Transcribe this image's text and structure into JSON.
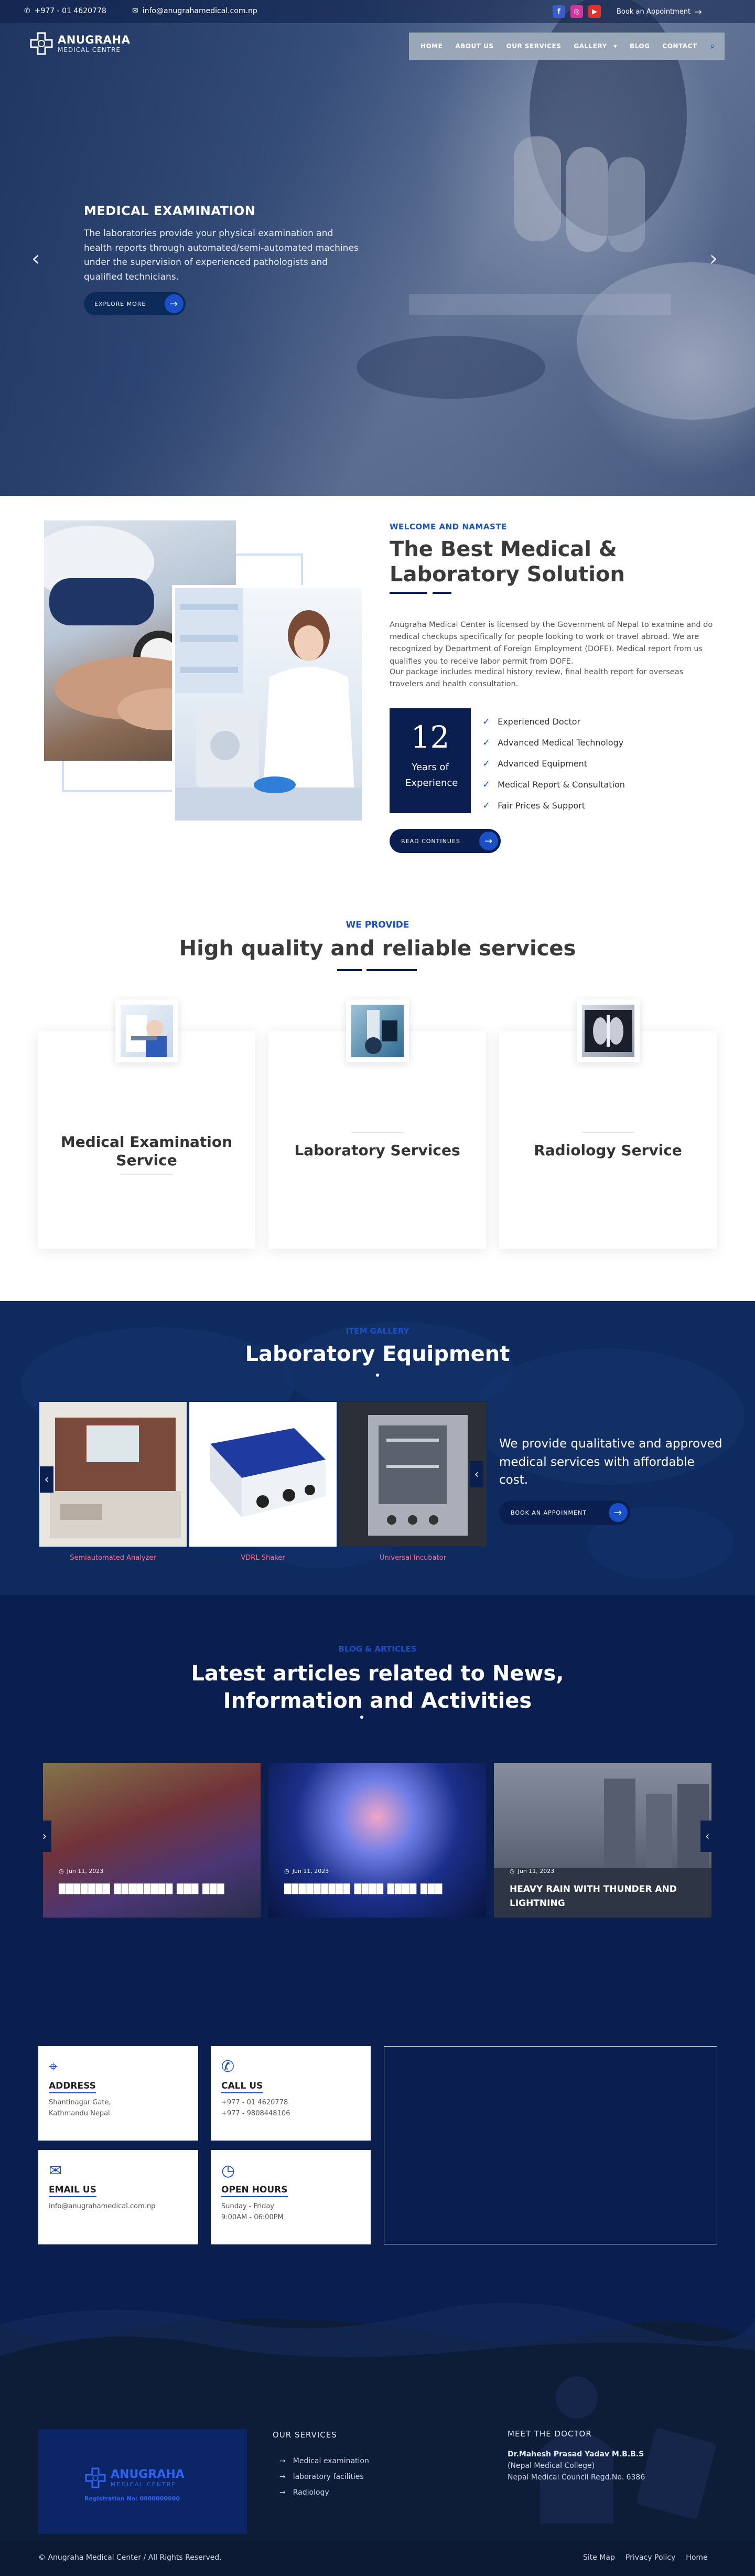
{
  "topbar": {
    "phone": "+977 - 01 4620778",
    "email": "info@anugrahamedical.com.np",
    "social": [
      "f",
      "◎",
      "▶"
    ],
    "appointment": "Book an Appointment"
  },
  "brand": {
    "name": "ANUGRAHA",
    "sub": "MEDICAL CENTRE"
  },
  "nav": {
    "items": [
      "HOME",
      "ABOUT US",
      "OUR SERVICES",
      "GALLERY",
      "BLOG",
      "CONTACT"
    ],
    "gallery_caret": "▾"
  },
  "hero": {
    "title": "MEDICAL EXAMINATION",
    "text": "The laboratories provide your physical examination and health reports through automated/semi-automated machines under the supervision of experienced pathologists and qualified technicians.",
    "button": "EXPLORE MORE"
  },
  "about": {
    "kicker": "WELCOME AND NAMASTE",
    "title_line1": "The Best Medical &",
    "title_line2": "Laboratory Solution",
    "p1": "Anugraha Medical Center is licensed by the Government of Nepal to examine and do medical checkups specifically for people looking to work or travel abroad. We are recognized by Department of Foreign Employment (DOFE). Medical report from us qualifies you to receive labor permit from DOFE.",
    "p2": "Our package includes medical history review, final health report for overseas travelers and health consultation.",
    "years": "12",
    "years_label": "Years of Experience",
    "features": [
      "Experienced Doctor",
      "Advanced Medical Technology",
      "Advanced Equipment",
      "Medical Report & Consultation",
      "Fair Prices & Support"
    ],
    "button": "READ CONTINUES"
  },
  "services": {
    "kicker": "WE PROVIDE",
    "title": "High quality and reliable services",
    "cards": [
      {
        "line1": "Medical Examination",
        "line2": "Service"
      },
      {
        "line1": "Laboratory Services",
        "line2": ""
      },
      {
        "line1": "Radiology Service",
        "line2": ""
      }
    ]
  },
  "gallery": {
    "kicker": "ITEM GALLERY",
    "title": "Laboratory Equipment",
    "items": [
      "Semiautomated Analyzer",
      "VDRL Shaker",
      "Universal Incubator"
    ],
    "text": "We provide qualitative and approved medical services with affordable cost.",
    "button": "BOOK AN APPOINMENT"
  },
  "blog": {
    "kicker": "BLOG & ARTICLES",
    "title_line1": "Latest articles related to News,",
    "title_line2": "Information and Activities",
    "posts": [
      {
        "date": "Jun 11, 2023",
        "title": "███████ ████████ ███ ███"
      },
      {
        "date": "Jun 11, 2023",
        "title": "█████████ ████ ████ ███"
      },
      {
        "date": "Jun 11, 2023",
        "title": "HEAVY RAIN WITH THUNDER AND LIGHTNING"
      }
    ]
  },
  "contact": {
    "address_title": "ADDRESS",
    "address_1": "Shantinagar Gate,",
    "address_2": "Kathmandu Nepal",
    "call_title": "CALL US",
    "call_1": "+977 - 01 4620778",
    "call_2": "+977 - 9808448106",
    "email_title": "EMAIL US",
    "email": "info@anugrahamedical.com.np",
    "hours_title": "OPEN HOURS",
    "hours_1": "Sunday - Friday",
    "hours_2": "9:00AM - 06:00PM"
  },
  "footer": {
    "brand": "ANUGRAHA",
    "brand_sub": "MEDICAL CENTRE",
    "reg": "Registration No: 0000000000",
    "services_title": "OUR SERVICES",
    "services": [
      "Medical examination",
      "laboratory facilities",
      "Radiology"
    ],
    "doctor_title": "MEET THE DOCTOR",
    "doctor_name": "Dr.Mahesh Prasad Yadav M.B.B.S",
    "doctor_college": "(Nepal Medical College)",
    "doctor_reg": "Nepal Medical Council Regd.No. 6386",
    "copyright": "© Anugraha Medical Center / All Rights Reserved.",
    "links": [
      "Site Map",
      "Privacy Policy",
      "Home"
    ]
  },
  "colors": {
    "accent": "#1b4fc8",
    "navy": "#0a1f4f",
    "gallery_bg": "#0f2a5e",
    "footer": "#0d1d38"
  }
}
